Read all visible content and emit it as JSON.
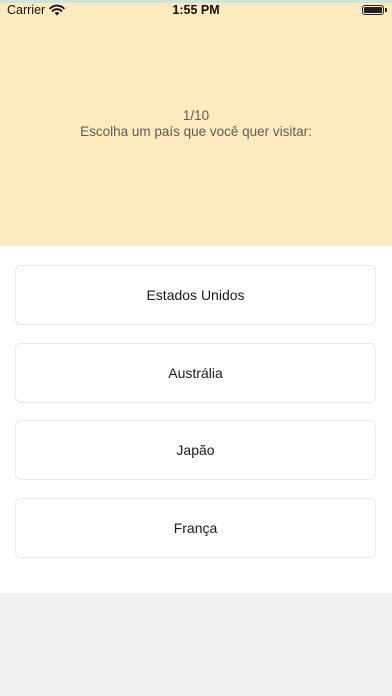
{
  "status_bar": {
    "carrier": "Carrier",
    "time": "1:55 PM",
    "wifi_icon": "wifi-icon",
    "battery_icon": "battery-icon"
  },
  "quiz": {
    "progress": "1/10",
    "question": "Escolha um país que você quer visitar:",
    "options": [
      "Estados Unidos",
      "Austrália",
      "Japão",
      "França"
    ]
  },
  "colors": {
    "header_bg": "#fdebbd",
    "page_bg": "#f1f1f3",
    "option_bg": "#ffffff"
  }
}
